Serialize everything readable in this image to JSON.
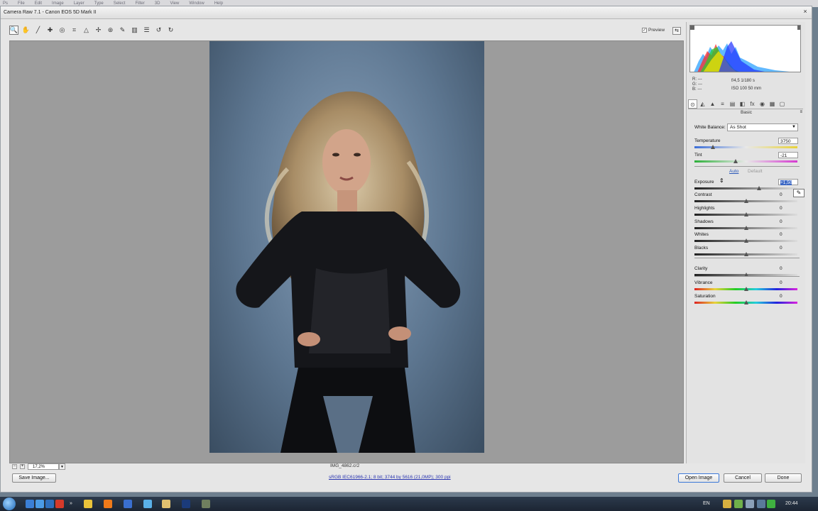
{
  "background_menu": [
    "Ps",
    "File",
    "Edit",
    "Image",
    "Layer",
    "Type",
    "Select",
    "Filter",
    "3D",
    "View",
    "Window",
    "Help"
  ],
  "window": {
    "title": "Camera Raw 7.1  -  Canon EOS 5D Mark II",
    "close_glyph": "×"
  },
  "toolbar": {
    "tools": [
      {
        "name": "zoom-tool-icon",
        "glyph": "🔍"
      },
      {
        "name": "hand-tool-icon",
        "glyph": "✋"
      },
      {
        "name": "white-balance-tool-icon",
        "glyph": "╱"
      },
      {
        "name": "color-sampler-tool-icon",
        "glyph": "✚"
      },
      {
        "name": "targeted-adjustment-tool-icon",
        "glyph": "◎"
      },
      {
        "name": "crop-tool-icon",
        "glyph": "⌗"
      },
      {
        "name": "straighten-tool-icon",
        "glyph": "△"
      },
      {
        "name": "spot-removal-tool-icon",
        "glyph": "✢"
      },
      {
        "name": "red-eye-removal-tool-icon",
        "glyph": "⊛"
      },
      {
        "name": "adjustment-brush-icon",
        "glyph": "✎"
      },
      {
        "name": "graduated-filter-icon",
        "glyph": "▥"
      },
      {
        "name": "preferences-icon",
        "glyph": "☰"
      },
      {
        "name": "rotate-ccw-icon",
        "glyph": "↺"
      },
      {
        "name": "rotate-cw-icon",
        "glyph": "↻"
      }
    ],
    "preview_label": "Preview",
    "preview_checked": "✓",
    "fullscreen_glyph": "⇆"
  },
  "status": {
    "zoom_value": "17,2%",
    "zoom_minus": "−",
    "zoom_plus": "+",
    "zoom_caret": "▼",
    "filename": "IMG_4862.cr2"
  },
  "histogram": {
    "r": "R:  ---",
    "g": "G:  ---",
    "b": "B:  ---",
    "aperture_shutter": "f/4,5   1/180 s",
    "iso_focal": "ISO 100    50 mm"
  },
  "panel": {
    "tabs": [
      "⊙",
      "◭",
      "▲",
      "≡",
      "▤",
      "◧",
      "fx",
      "◉",
      "▦",
      "▢"
    ],
    "title": "Basic",
    "menu_glyph": "≡",
    "white_balance_label": "White Balance:",
    "white_balance_value": "As Shot",
    "auto_label": "Auto",
    "default_label": "Default",
    "pencil_glyph": "✎",
    "cursor_glyph": "⇕"
  },
  "sliders": [
    {
      "key": "temperature",
      "label": "Temperature",
      "value": "3750",
      "pos": 0.18,
      "track": "temp"
    },
    {
      "key": "tint",
      "label": "Tint",
      "value": "-21",
      "pos": 0.4,
      "track": "tint"
    },
    {
      "key": "exposure",
      "label": "Exposure",
      "value": "+1,50",
      "pos": 0.63,
      "track": "gray",
      "selected": true
    },
    {
      "key": "contrast",
      "label": "Contrast",
      "value": "0",
      "pos": 0.5,
      "track": "gray"
    },
    {
      "key": "highlights",
      "label": "Highlights",
      "value": "0",
      "pos": 0.5,
      "track": "gray"
    },
    {
      "key": "shadows",
      "label": "Shadows",
      "value": "0",
      "pos": 0.5,
      "track": "gray"
    },
    {
      "key": "whites",
      "label": "Whites",
      "value": "0",
      "pos": 0.5,
      "track": "gray"
    },
    {
      "key": "blacks",
      "label": "Blacks",
      "value": "0",
      "pos": 0.5,
      "track": "gray"
    },
    {
      "key": "clarity",
      "label": "Clarity",
      "value": "0",
      "pos": 0.5,
      "track": "gray"
    },
    {
      "key": "vibrance",
      "label": "Vibrance",
      "value": "0",
      "pos": 0.5,
      "track": "color"
    },
    {
      "key": "saturation",
      "label": "Saturation",
      "value": "0",
      "pos": 0.5,
      "track": "color"
    }
  ],
  "footer": {
    "save_image": "Save Image...",
    "workflow_options": "sRGB IEC61966-2.1; 8 bit; 3744 by 5616 (21,0MP); 300 ppi",
    "open_image": "Open Image",
    "cancel": "Cancel",
    "done": "Done"
  },
  "taskbar": {
    "lang": "EN",
    "time": "20:44",
    "chevron": "»"
  },
  "colors": {
    "accent": "#3a66c4",
    "link": "#2a35b0",
    "backdrop": "#5d7690"
  }
}
